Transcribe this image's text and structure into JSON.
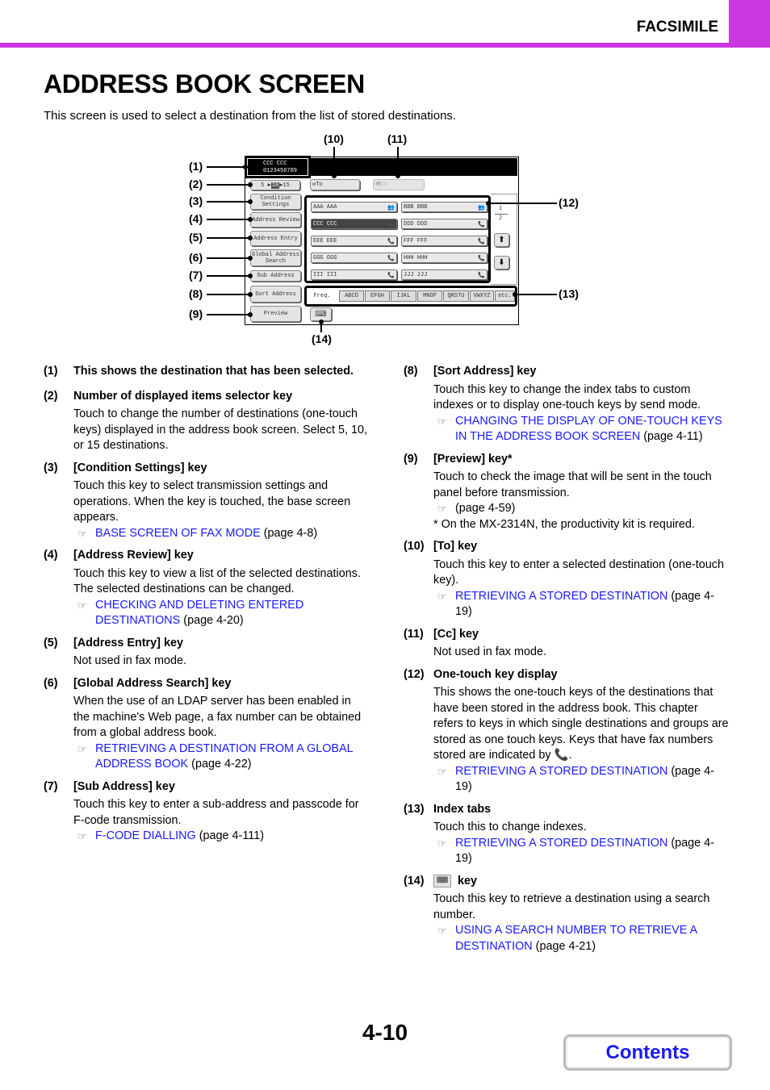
{
  "header": {
    "section": "FACSIMILE",
    "accent": "#c837e0"
  },
  "title": "ADDRESS BOOK SCREEN",
  "intro": "This screen is used to select a destination from the list of stored destinations.",
  "diagram": {
    "selected_name": "CCC CCC",
    "selected_number": "0123456789",
    "count_selector": {
      "opt1": "5",
      "opt2": "10",
      "opt3": "15"
    },
    "to_label": "To",
    "cc_label": "Cc",
    "left_keys": {
      "condition": "Condition Settings",
      "review": "Address Review",
      "entry": "Address Entry",
      "global": "Global Address Search",
      "sub": "Sub Address",
      "sort": "Sort Address",
      "preview": "Preview"
    },
    "one_touch": [
      "AAA AAA",
      "BBB BBB",
      "CCC CCC",
      "DDD DDD",
      "EEE EEE",
      "FFF FFF",
      "GGG GGG",
      "HHH HHH",
      "III III",
      "JJJ JJJ"
    ],
    "page_current": "1",
    "page_total": "2",
    "tabs": [
      "Freq.",
      "ABCD",
      "EFGH",
      "IJKL",
      "MNOP",
      "QRSTU",
      "VWXYZ",
      "etc."
    ],
    "callouts": [
      "(1)",
      "(2)",
      "(3)",
      "(4)",
      "(5)",
      "(6)",
      "(7)",
      "(8)",
      "(9)",
      "(10)",
      "(11)",
      "(12)",
      "(13)",
      "(14)"
    ]
  },
  "left_items": [
    {
      "num": "(1)",
      "title": "This shows the destination that has been selected."
    },
    {
      "num": "(2)",
      "title": "Number of displayed items selector key",
      "body": "Touch to change the number of destinations (one-touch keys) displayed in the address book screen. Select 5, 10, or 15 destinations."
    },
    {
      "num": "(3)",
      "title": "[Condition Settings] key",
      "body": "Touch this key to select transmission settings and operations. When the key is touched, the base screen appears.",
      "link": "BASE SCREEN OF FAX MODE",
      "page": " (page 4-8)"
    },
    {
      "num": "(4)",
      "title": "[Address Review] key",
      "body": "Touch this key to view a list of the selected destinations. The selected destinations can be changed.",
      "link": "CHECKING AND DELETING ENTERED DESTINATIONS",
      "page": " (page 4-20)"
    },
    {
      "num": "(5)",
      "title": "[Address Entry] key",
      "body": "Not used in fax mode."
    },
    {
      "num": "(6)",
      "title": "[Global Address Search] key",
      "body": "When the use of an LDAP server has been enabled in the machine's Web page, a fax number can be obtained from a global address book.",
      "link": "RETRIEVING A DESTINATION FROM A GLOBAL ADDRESS BOOK",
      "page": " (page 4-22)"
    },
    {
      "num": "(7)",
      "title": "[Sub Address] key",
      "body": "Touch this key to enter a sub-address and passcode for F-code transmission.",
      "link": "F-CODE DIALLING",
      "page": " (page 4-111)"
    }
  ],
  "right_items": [
    {
      "num": "(8)",
      "title": "[Sort Address] key",
      "body": "Touch this key to change the index tabs to custom indexes or to display one-touch keys by send mode.",
      "link": "CHANGING THE DISPLAY OF ONE-TOUCH KEYS IN THE ADDRESS BOOK SCREEN",
      "page": " (page 4-11)"
    },
    {
      "num": "(9)",
      "title": "[Preview] key*",
      "body": "Touch to check the image that will be sent in the touch panel before transmission.",
      "link": "",
      "page": "(page 4-59)",
      "note": "* On the MX-2314N, the productivity kit is required."
    },
    {
      "num": "(10)",
      "title": "[To] key",
      "body": "Touch this key to enter a selected destination (one-touch key).",
      "link": "RETRIEVING A STORED DESTINATION",
      "page": " (page 4-19)"
    },
    {
      "num": "(11)",
      "title": "[Cc] key",
      "body": "Not used in fax mode."
    },
    {
      "num": "(12)",
      "title": "One-touch key display",
      "body": "This shows the one-touch keys of the destinations that have been stored in the address book. This chapter refers to keys in which single destinations and groups are stored as one touch keys. Keys that have fax numbers stored are indicated by",
      "body_end": ".",
      "link": "RETRIEVING A STORED DESTINATION",
      "page": " (page 4-19)"
    },
    {
      "num": "(13)",
      "title": "Index tabs",
      "body": "Touch this to change indexes.",
      "link": "RETRIEVING A STORED DESTINATION",
      "page": " (page 4-19)"
    },
    {
      "num": "(14)",
      "title": "key",
      "body": "Touch this key to retrieve a destination using a search number.",
      "link": "USING A SEARCH NUMBER TO RETRIEVE A DESTINATION",
      "page": " (page 4-21)"
    }
  ],
  "footer": {
    "page_number": "4-10",
    "contents": "Contents"
  }
}
